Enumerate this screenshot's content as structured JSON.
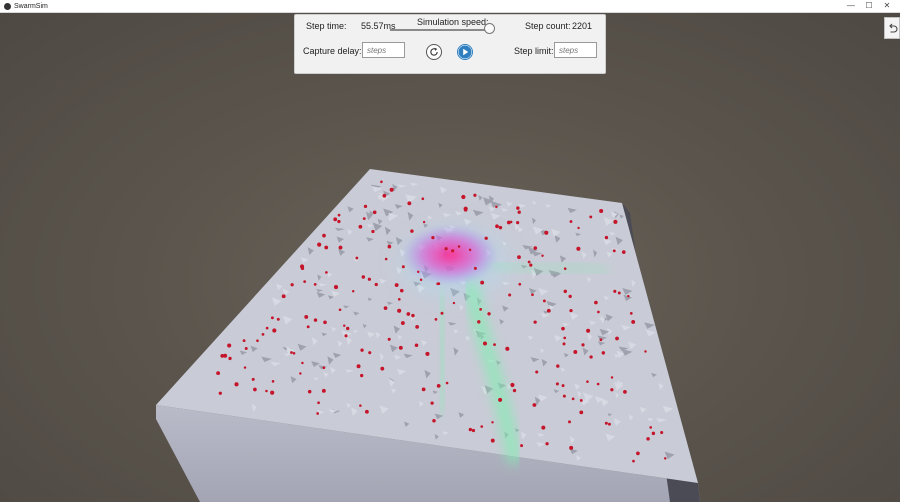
{
  "window": {
    "title": "SwarmSim",
    "controls": [
      "—",
      "☐",
      "✕"
    ]
  },
  "panel": {
    "step_time_label": "Step time:",
    "step_time_value": "55.57ms",
    "speed_label": "Simulation speed:",
    "speed_level": 1.0,
    "step_count_label": "Step count:",
    "step_count_value": "2201",
    "capture_delay_label": "Capture delay:",
    "capture_delay_placeholder": "steps",
    "step_limit_label": "Step limit:",
    "step_limit_placeholder": "steps"
  },
  "icons": {
    "reset": "reset-icon",
    "play": "play-icon",
    "back": "undo-icon"
  },
  "colors": {
    "background": "#5a544c",
    "terrain": "#c9cbd6",
    "hotspot": "#ff2a8c",
    "trail": "#7ff0b0",
    "agent": "#c4152a",
    "accent": "#2f7fc0"
  }
}
